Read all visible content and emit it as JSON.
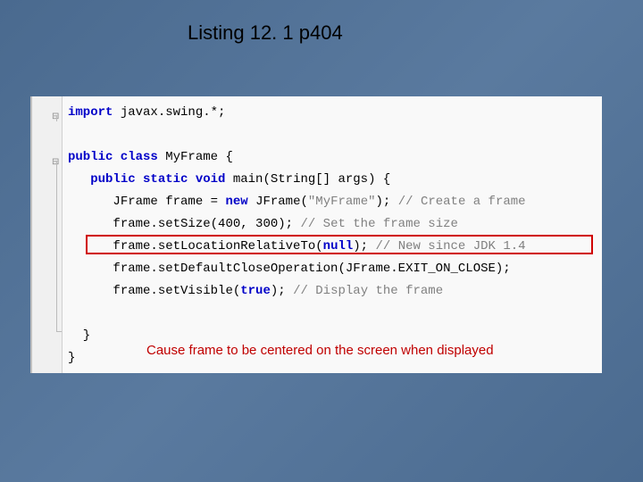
{
  "title": "Listing 12. 1 p404",
  "caption": "Cause frame to be centered on the screen when displayed",
  "code": {
    "line1_kw": "import",
    "line1_rest": " javax.swing.*;",
    "line2_kw1": "public class",
    "line2_name": " MyFrame {",
    "line3_kw": "public static void",
    "line3_name": " main",
    "line3_rest": "(String[] args) {",
    "line4_a": "JFrame frame = ",
    "line4_kw": "new",
    "line4_b": " JFrame(",
    "line4_str": "\"MyFrame\"",
    "line4_c": "); ",
    "line4_cmt": "// Create a frame",
    "line5_a": "frame.setSize(400, 300); ",
    "line5_cmt": "// Set the frame size",
    "line6_a": "frame.setLocationRelativeTo(",
    "line6_kw": "null",
    "line6_b": "); ",
    "line6_cmt": "// New since JDK 1.4",
    "line7_a": "frame.setDefaultCloseOperation(JFrame.EXIT_ON_CLOSE);",
    "line8_a": "frame.setVisible(",
    "line8_kw": "true",
    "line8_b": "); ",
    "line8_cmt": "// Display the frame",
    "line9": "  }",
    "line10": "}"
  },
  "fold1": "⊟",
  "fold2": "⊟"
}
